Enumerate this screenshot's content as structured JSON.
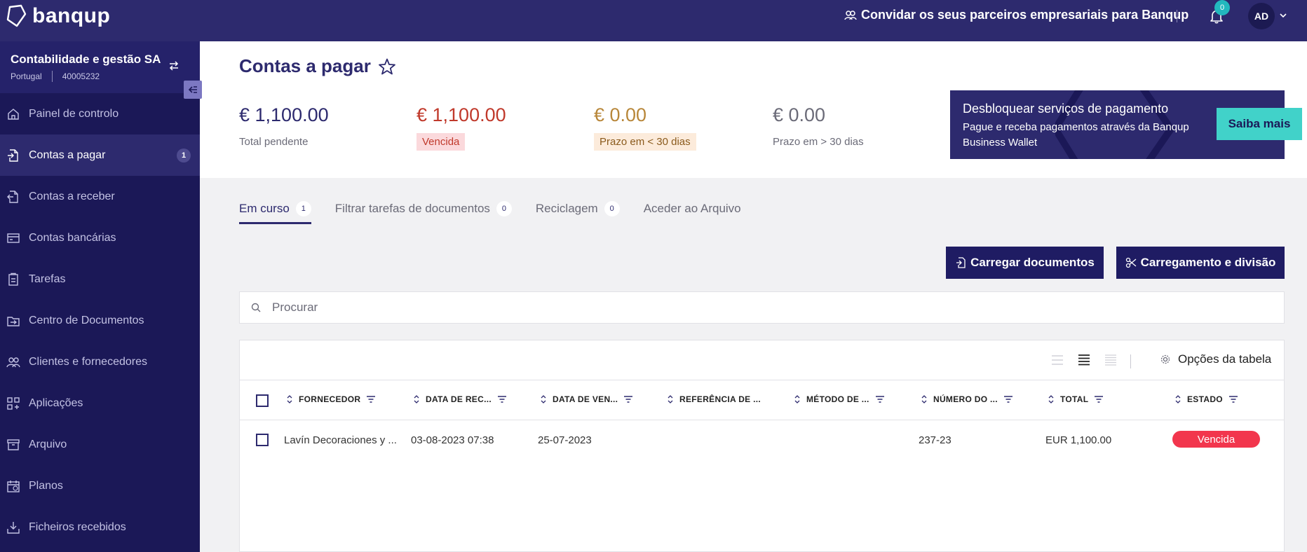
{
  "topbar": {
    "logo_text": "banqup",
    "invite_label": "Convidar os seus parceiros empresariais para Banqup",
    "notifications_count": "0",
    "avatar_initials": "AD"
  },
  "sidebar": {
    "org_name": "Contabilidade e gestão SA",
    "org_country": "Portugal",
    "org_id": "40005232",
    "items": [
      {
        "label": "Painel de controlo",
        "icon": "home-icon"
      },
      {
        "label": "Contas a pagar",
        "icon": "document-out-icon",
        "badge": "1",
        "active": true
      },
      {
        "label": "Contas a receber",
        "icon": "document-in-icon"
      },
      {
        "label": "Contas bancárias",
        "icon": "bank-card-icon"
      },
      {
        "label": "Tarefas",
        "icon": "clipboard-icon"
      },
      {
        "label": "Centro de Documentos",
        "icon": "documents-center-icon"
      },
      {
        "label": "Clientes e fornecedores",
        "icon": "people-icon"
      },
      {
        "label": "Aplicações",
        "icon": "apps-icon"
      },
      {
        "label": "Arquivo",
        "icon": "archive-icon"
      },
      {
        "label": "Planos",
        "icon": "calendar-icon"
      },
      {
        "label": "Ficheiros recebidos",
        "icon": "download-tray-icon"
      }
    ]
  },
  "page": {
    "title": "Contas a pagar"
  },
  "stats": [
    {
      "amount": "€ 1,100.00",
      "label": "Total pendente",
      "amount_color": "#2d2a6e",
      "label_bg": "",
      "label_color": "#6b6b78"
    },
    {
      "amount": "€ 1,100.00",
      "label": "Vencida",
      "amount_color": "#c0392b",
      "label_bg": "#fbd9dc",
      "label_color": "#c0392b"
    },
    {
      "amount": "€ 0.00",
      "label": "Prazo em < 30 dias",
      "amount_color": "#b8873a",
      "label_bg": "#fcebdb",
      "label_color": "#8a5a1c"
    },
    {
      "amount": "€ 0.00",
      "label": "Prazo em > 30 dias",
      "amount_color": "#6b6b78",
      "label_bg": "",
      "label_color": "#6b6b78"
    }
  ],
  "promo": {
    "title": "Desbloquear serviços de pagamento",
    "text": "Pague e receba pagamentos através da Banqup Business Wallet",
    "button": "Saiba mais"
  },
  "tabs": [
    {
      "label": "Em curso",
      "count": "1",
      "active": true
    },
    {
      "label": "Filtrar tarefas de documentos",
      "count": "0"
    },
    {
      "label": "Reciclagem",
      "count": "0"
    },
    {
      "label": "Aceder ao Arquivo",
      "count": ""
    }
  ],
  "actions": {
    "upload": "Carregar documentos",
    "split": "Carregamento e divisão"
  },
  "search": {
    "placeholder": "Procurar"
  },
  "table": {
    "options_label": "Opções da tabela",
    "columns": [
      "FORNECEDOR",
      "DATA DE REC...",
      "DATA DE VEN...",
      "REFERÊNCIA DE ...",
      "MÉTODO DE ...",
      "NÚMERO DO ...",
      "TOTAL",
      "ESTADO"
    ],
    "rows": [
      {
        "supplier": "Lavín Decoraciones y ...",
        "received": "03-08-2023 07:38",
        "due": "25-07-2023",
        "reference": "",
        "method": "",
        "number": "237-23",
        "total": "EUR 1,100.00",
        "status": "Vencida"
      }
    ]
  },
  "colors": {
    "brand_dark": "#2d2a6e",
    "sidebar": "#1b1857",
    "accent_teal": "#41d2c9",
    "overdue_red": "#f2364d"
  }
}
